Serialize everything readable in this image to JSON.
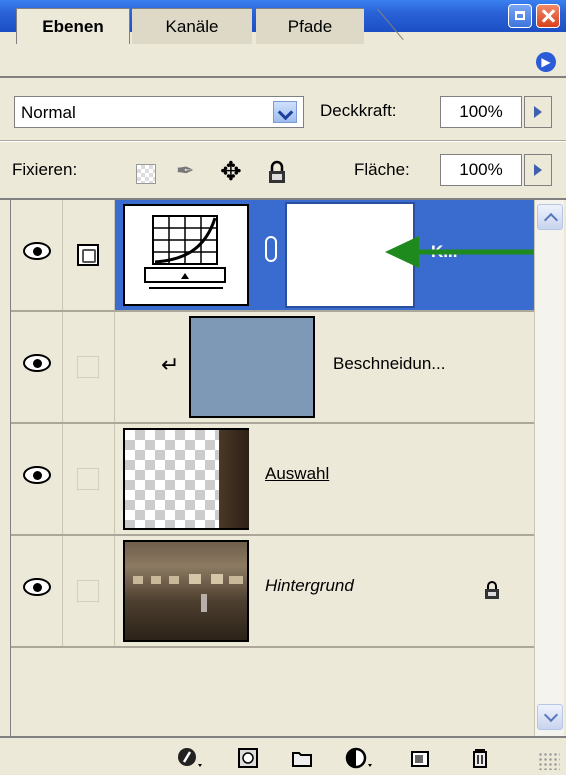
{
  "tabs": [
    {
      "label": "Ebenen"
    },
    {
      "label": "Kanäle"
    },
    {
      "label": "Pfade"
    }
  ],
  "blend": {
    "value": "Normal"
  },
  "opacity": {
    "label": "Deckkraft:",
    "value": "100%"
  },
  "lock": {
    "label": "Fixieren:"
  },
  "fill": {
    "label": "Fläche:",
    "value": "100%"
  },
  "layers": [
    {
      "name": "K...",
      "selected": true
    },
    {
      "name": "Beschneidun..."
    },
    {
      "name": "Auswahl"
    },
    {
      "name": "Hintergrund",
      "locked": true
    }
  ],
  "colors": {
    "selection": "#3a6cd0",
    "arrow": "#1e8a1e",
    "solid_fill": "#7d99b5"
  },
  "icons": [
    "eye-icon",
    "link-icon",
    "lock-icon",
    "layer-styles-icon",
    "mask-icon",
    "folder-icon",
    "adjustment-icon",
    "new-layer-icon",
    "trash-icon"
  ]
}
